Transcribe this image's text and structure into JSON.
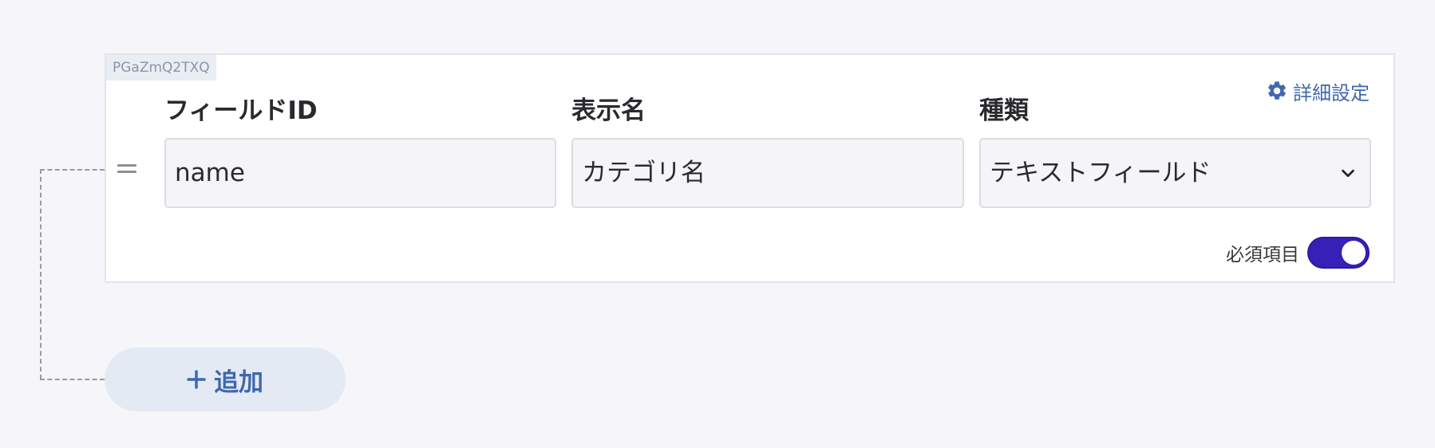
{
  "field_card": {
    "id_tag": "PGaZmQ2TXQ",
    "settings_link": "詳細設定",
    "columns": {
      "field_id": {
        "label": "フィールドID",
        "value": "name"
      },
      "display_name": {
        "label": "表示名",
        "value": "カテゴリ名"
      },
      "type": {
        "label": "種類",
        "value": "テキストフィールド"
      }
    },
    "required": {
      "label": "必須項目",
      "enabled": true
    }
  },
  "add_button": {
    "label": "追加"
  },
  "colors": {
    "accent": "#3f68ad",
    "toggle_on": "#3521b8",
    "background": "#f6f6fa",
    "card": "#ffffff"
  },
  "icons": [
    "gear-icon",
    "drag-handle-icon",
    "chevron-down-icon",
    "plus-icon"
  ]
}
